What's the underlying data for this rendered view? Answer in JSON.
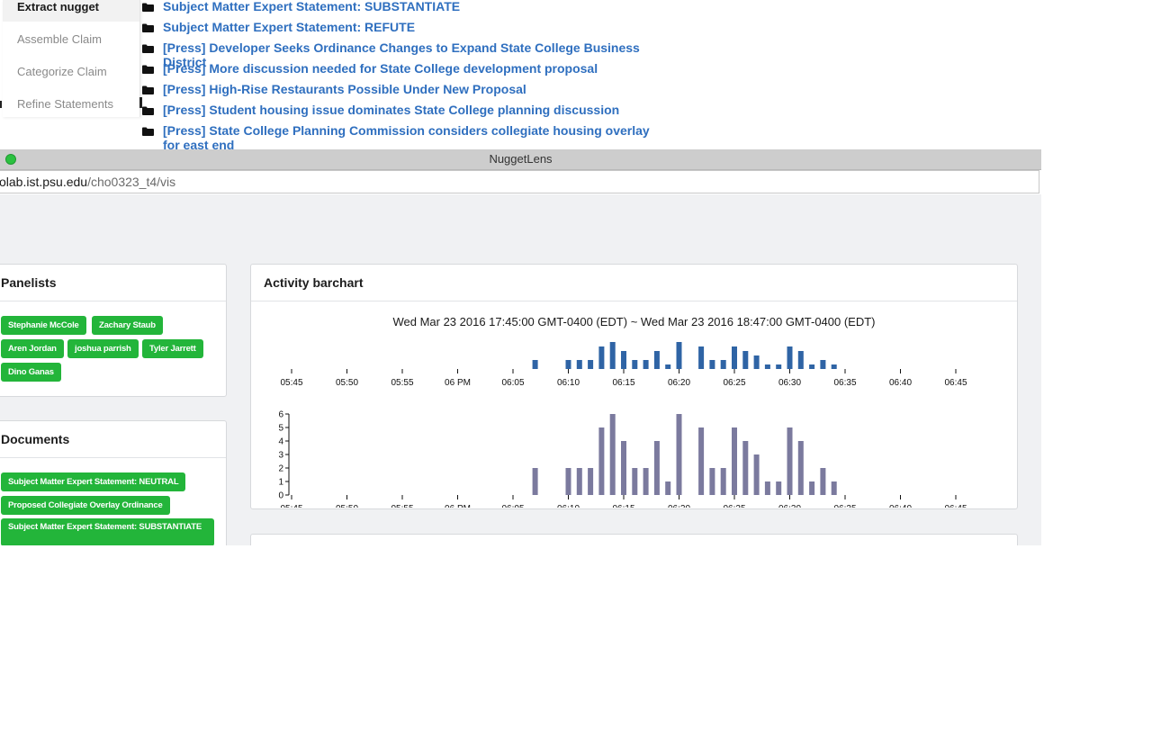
{
  "menu": {
    "items": [
      {
        "label": "Extract nugget",
        "active": true
      },
      {
        "label": "Assemble Claim",
        "active": false
      },
      {
        "label": "Categorize Claim",
        "active": false
      },
      {
        "label": "Refine Statements",
        "active": false
      }
    ]
  },
  "documents_list": [
    "Subject Matter Expert Statement: SUBSTANTIATE",
    "Subject Matter Expert Statement: REFUTE",
    "[Press] Developer Seeks Ordinance Changes to Expand State College Business District",
    "[Press] More discussion needed for State College development proposal",
    "[Press] High-Rise Restaurants Possible Under New Proposal",
    "[Press] Student housing issue dominates State College planning discussion",
    "[Press] State College Planning Commission considers collegiate housing overlay for east end"
  ],
  "window": {
    "title": "NuggetLens",
    "url_host": "olab.ist.psu.edu",
    "url_path": "/cho0323_t4/vis"
  },
  "panelists": {
    "title": "Panelists",
    "names": [
      "Stephanie McCole",
      "Zachary Staub",
      "Aren Jordan",
      "joshua parrish",
      "Tyler Jarrett",
      "Dino Ganas"
    ]
  },
  "documents": {
    "title": "Documents",
    "items": [
      "Subject Matter Expert Statement: NEUTRAL",
      "Proposed Collegiate Overlay Ordinance",
      "Subject Matter Expert Statement: SUBSTANTIATE"
    ]
  },
  "activity": {
    "title": "Activity barchart",
    "range": "Wed Mar 23 2016 17:45:00 GMT-0400 (EDT) ~ Wed Mar 23 2016 18:47:00 GMT-0400 (EDT)"
  },
  "colors": {
    "accent_green": "#23b53a",
    "link_blue": "#2f6fbf",
    "bar_blue": "#2f64a5",
    "bar_purple": "#7b7a9e"
  },
  "chart_data": {
    "type": "bar",
    "x_tick_labels": [
      "05:45",
      "05:50",
      "05:55",
      "06 PM",
      "06:05",
      "06:10",
      "06:15",
      "06:20",
      "06:25",
      "06:30",
      "06:35",
      "06:40",
      "06:45"
    ],
    "ylim": [
      0,
      6
    ],
    "y_ticks": [
      0,
      1,
      2,
      3,
      4,
      5,
      6
    ],
    "series": [
      {
        "minutes": [
          67,
          70,
          71,
          72,
          73,
          74,
          75,
          76,
          77,
          78,
          79,
          80,
          82,
          83,
          84,
          85,
          86,
          87,
          88,
          89,
          90,
          91,
          92,
          93,
          94
        ],
        "values": [
          2,
          2,
          2,
          2,
          5,
          6,
          4,
          2,
          2,
          4,
          1,
          6,
          5,
          2,
          2,
          5,
          4,
          3,
          1,
          1,
          5,
          4,
          1,
          2,
          1
        ]
      }
    ]
  }
}
